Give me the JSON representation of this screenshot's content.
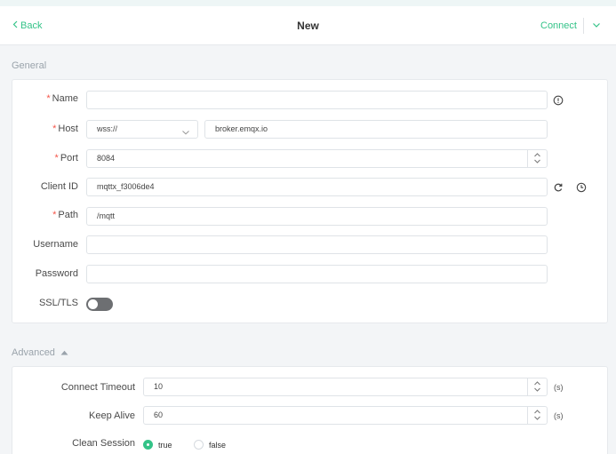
{
  "header": {
    "back_label": "Back",
    "title": "New",
    "connect_label": "Connect"
  },
  "general": {
    "section_title": "General",
    "fields": {
      "name": {
        "label": "Name",
        "required_mark": "*",
        "value": ""
      },
      "host": {
        "label": "Host",
        "required_mark": "*",
        "protocol": "wss://",
        "value": "broker.emqx.io"
      },
      "port": {
        "label": "Port",
        "required_mark": "*",
        "value": "8084"
      },
      "client_id": {
        "label": "Client ID",
        "value": "mqttx_f3006de4"
      },
      "path": {
        "label": "Path",
        "required_mark": "*",
        "value": "/mqtt"
      },
      "username": {
        "label": "Username",
        "value": ""
      },
      "password": {
        "label": "Password",
        "value": ""
      },
      "ssl_tls": {
        "label": "SSL/TLS",
        "enabled": false
      }
    }
  },
  "advanced": {
    "section_title": "Advanced",
    "connect_timeout": {
      "label": "Connect Timeout",
      "value": "10",
      "unit": "(s)"
    },
    "keep_alive": {
      "label": "Keep Alive",
      "value": "60",
      "unit": "(s)"
    },
    "clean_session": {
      "label": "Clean Session",
      "options": [
        "true",
        "false"
      ],
      "selected": "true"
    }
  },
  "colors": {
    "accent": "#34c388",
    "required": "#f5564a",
    "toggle_off": "#6d6f72"
  },
  "icons": [
    "chevron-left-icon",
    "chevron-down-icon",
    "info-icon",
    "refresh-icon",
    "clock-icon",
    "caret-up-icon",
    "stepper-icon"
  ]
}
